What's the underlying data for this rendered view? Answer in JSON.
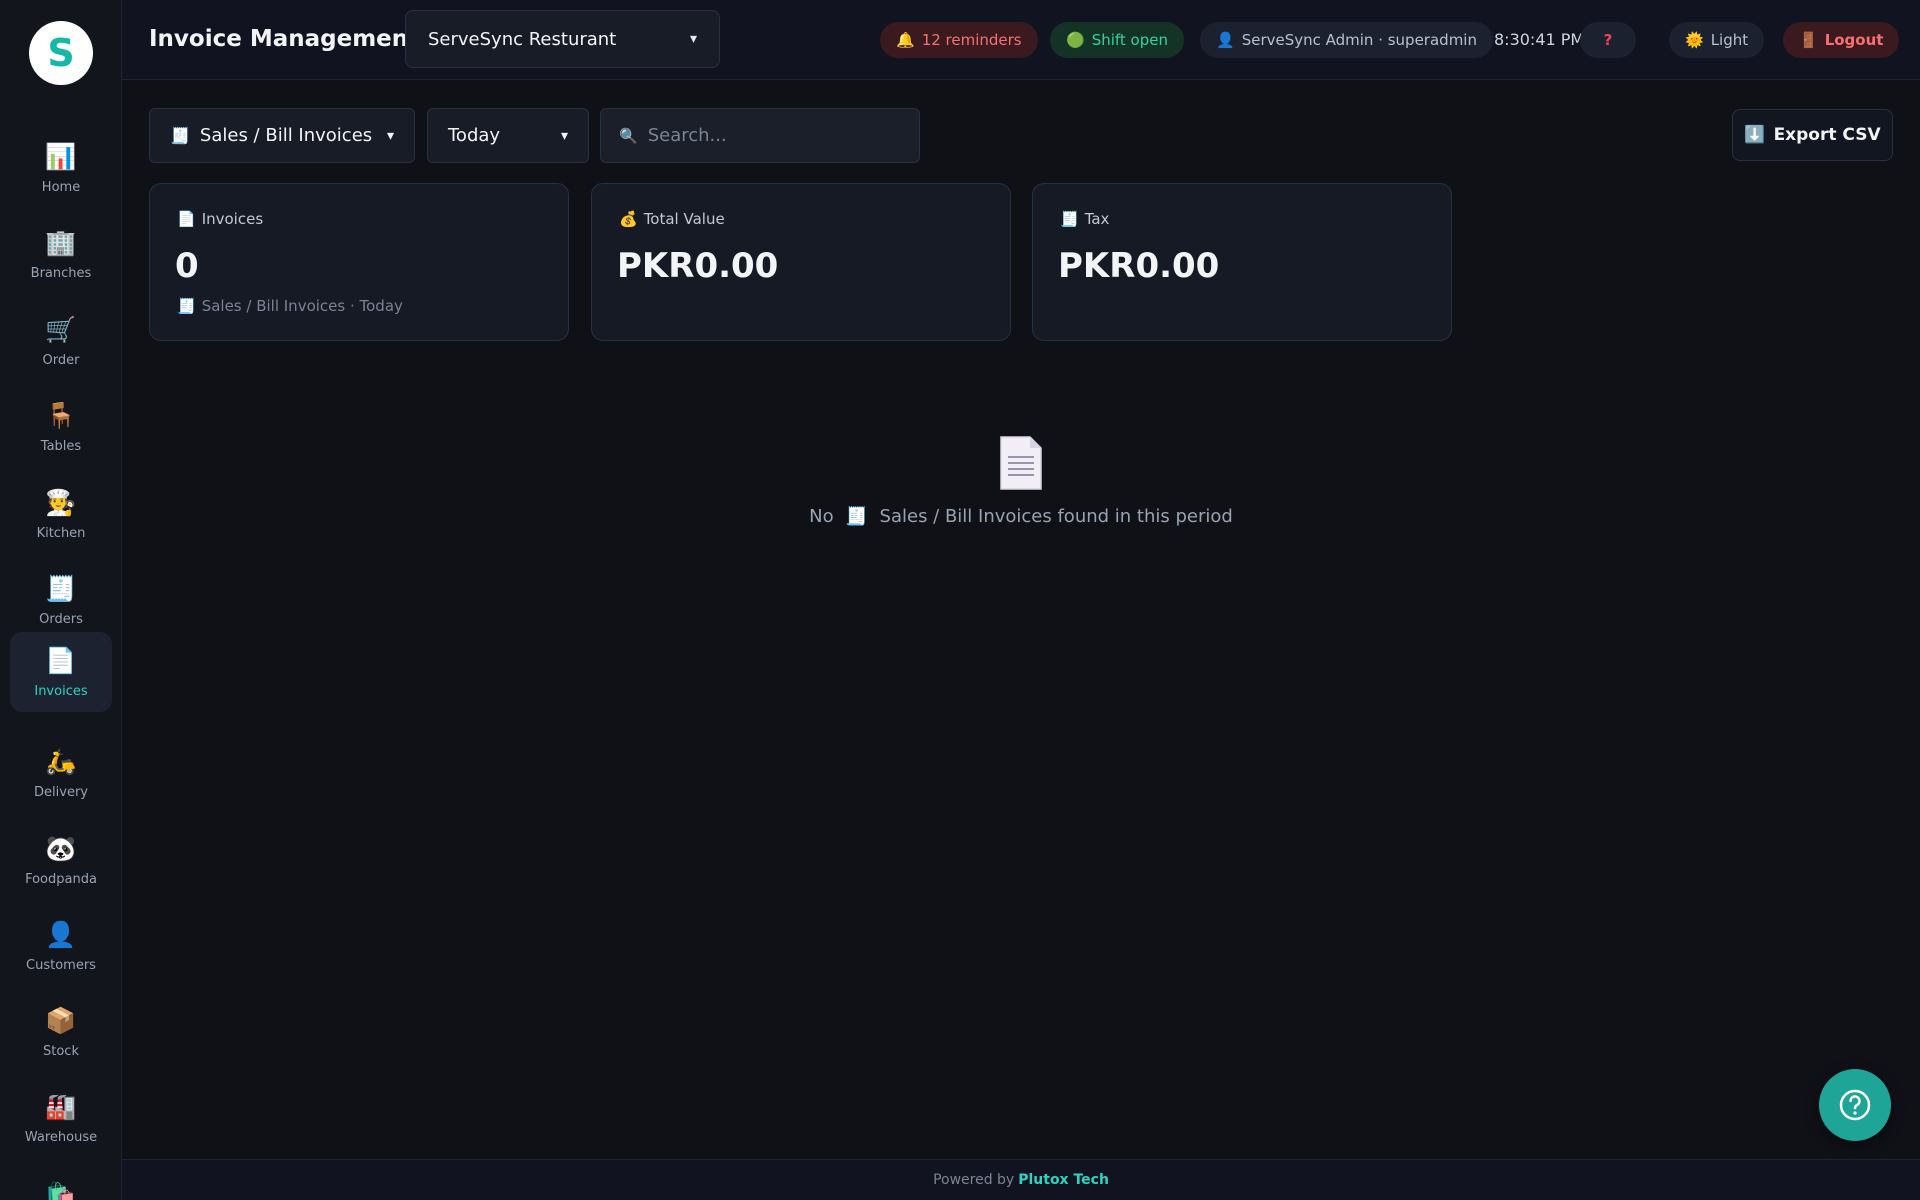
{
  "app": {
    "logo_letter": "S",
    "accent": "#2dd4bf"
  },
  "sidebar": {
    "items": [
      {
        "label": "Home",
        "icon": "📊",
        "icon_name": "chart-icon"
      },
      {
        "label": "Branches",
        "icon": "🏢",
        "icon_name": "building-icon"
      },
      {
        "label": "Order",
        "icon": "🛒",
        "icon_name": "cart-icon"
      },
      {
        "label": "Tables",
        "icon": "🪑",
        "icon_name": "chair-icon"
      },
      {
        "label": "Kitchen",
        "icon": "🧑‍🍳",
        "icon_name": "chef-icon"
      },
      {
        "label": "Orders",
        "icon": "🧾",
        "icon_name": "receipt-icon"
      },
      {
        "label": "Invoices",
        "icon": "📄",
        "icon_name": "document-icon",
        "active": true
      },
      {
        "label": "Delivery",
        "icon": "🛵",
        "icon_name": "scooter-icon"
      },
      {
        "label": "Foodpanda",
        "icon": "🐼",
        "icon_name": "panda-icon"
      },
      {
        "label": "Customers",
        "icon": "👤",
        "icon_name": "person-icon"
      },
      {
        "label": "Stock",
        "icon": "📦",
        "icon_name": "package-icon"
      },
      {
        "label": "Warehouse",
        "icon": "🏭",
        "icon_name": "factory-icon"
      },
      {
        "label": "",
        "icon": "🛍️",
        "icon_name": "shopping-bag-icon"
      }
    ]
  },
  "header": {
    "title": "Invoice Management",
    "branch": "ServeSync Resturant",
    "reminders": "12 reminders",
    "shift": "Shift open",
    "user": "ServeSync Admin · superadmin",
    "time": "8:30:41 PM",
    "help": "?",
    "theme": "Light",
    "logout": "Logout"
  },
  "filters": {
    "type": "Sales / Bill Invoices",
    "period": "Today",
    "search_placeholder": "Search...",
    "export": "Export CSV"
  },
  "cards": [
    {
      "label": "Invoices",
      "icon": "📄",
      "value": "0",
      "sub": "Sales / Bill Invoices · Today",
      "sub_icon": "🧾"
    },
    {
      "label": "Total Value",
      "icon": "💰",
      "value": "PKR0.00"
    },
    {
      "label": "Tax",
      "icon": "🧾",
      "value": "PKR0.00"
    }
  ],
  "empty": {
    "text_prefix": "No",
    "icon": "🧾",
    "text_suffix": "Sales / Bill Invoices found in this period"
  },
  "footer": {
    "prefix": "Powered by",
    "brand": "Plutox Tech"
  }
}
